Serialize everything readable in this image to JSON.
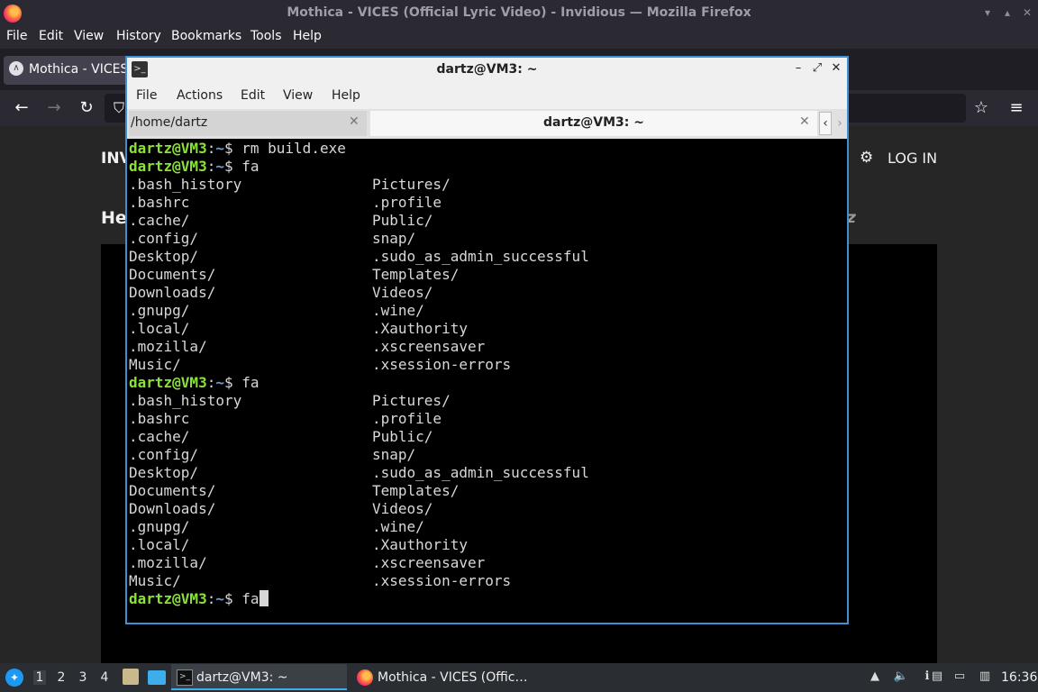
{
  "firefox": {
    "window_title": "Mothica - VICES (Official Lyric Video) - Invidious — Mozilla Firefox",
    "menu": [
      "File",
      "Edit",
      "View",
      "History",
      "Bookmarks",
      "Tools",
      "Help"
    ],
    "tab_title": "Mothica - VICES",
    "page": {
      "brand": "INV",
      "login": "LOG IN",
      "heading": "He",
      "trailing_text": "z"
    }
  },
  "terminal": {
    "window_title": "dartz@VM3: ~",
    "menu": [
      "File",
      "Actions",
      "Edit",
      "View",
      "Help"
    ],
    "tabs": [
      {
        "label": "/home/dartz",
        "active": false
      },
      {
        "label": "dartz@VM3: ~",
        "active": true
      }
    ],
    "prompt_user": "dartz@VM3",
    "prompt_sep": ":",
    "prompt_path": "~",
    "prompt_symbol": "$",
    "commands": {
      "first": "rm build.exe",
      "second": "fa",
      "third": "fa",
      "current": "fa"
    },
    "listing_col1": [
      ".bash_history",
      ".bashrc",
      ".cache/",
      ".config/",
      "Desktop/",
      "Documents/",
      "Downloads/",
      ".gnupg/",
      ".local/",
      ".mozilla/",
      "Music/"
    ],
    "listing_col2": [
      "Pictures/",
      ".profile",
      "Public/",
      "snap/",
      ".sudo_as_admin_successful",
      "Templates/",
      "Videos/",
      ".wine/",
      ".Xauthority",
      ".xscreensaver",
      ".xsession-errors"
    ]
  },
  "taskbar": {
    "workspaces": [
      "1",
      "2",
      "3",
      "4"
    ],
    "active_workspace": "1",
    "tasks": [
      {
        "label": "dartz@VM3: ~",
        "active": true
      },
      {
        "label": "Mothica - VICES (Offic…",
        "active": false
      }
    ],
    "clock": "16:36"
  }
}
